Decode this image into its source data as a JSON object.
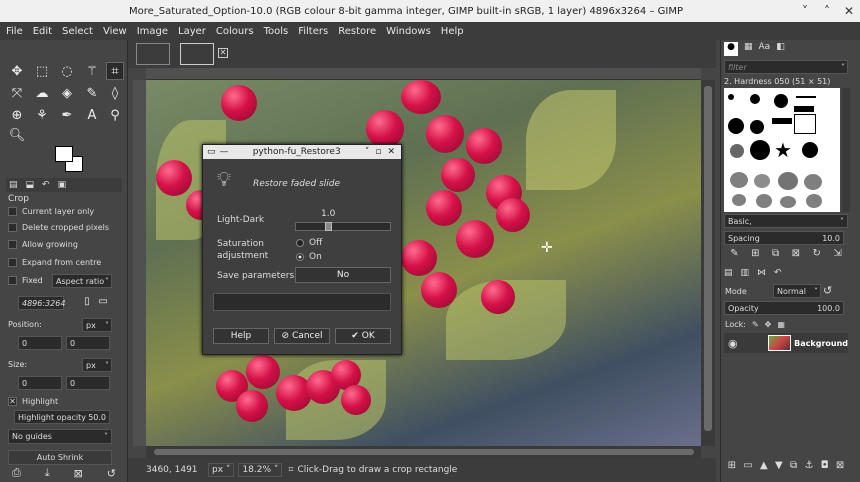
{
  "window": {
    "title": "More_Saturated_Option-10.0 (RGB colour 8-bit gamma integer, GIMP built-in sRGB, 1 layer) 4896x3264 – GIMP"
  },
  "menu": [
    "File",
    "Edit",
    "Select",
    "View",
    "Image",
    "Layer",
    "Colours",
    "Tools",
    "Filters",
    "Restore",
    "Windows",
    "Help"
  ],
  "tool_options": {
    "header": "Crop",
    "current_layer_only": "Current layer only",
    "delete_cropped_pixels": "Delete cropped pixels",
    "allow_growing": "Allow growing",
    "expand_from_centre": "Expand from centre",
    "fixed": "Fixed",
    "aspect_ratio": "Aspect ratio",
    "ratio_value": "4896:3264",
    "position_label": "Position:",
    "position_unit": "px",
    "position_x": "0",
    "position_y": "0",
    "size_label": "Size:",
    "size_unit": "px",
    "size_w": "0",
    "size_h": "0",
    "highlight": "Highlight",
    "highlight_opacity_label": "Highlight opacity",
    "highlight_opacity_value": "50.0",
    "guides": "No guides",
    "auto_shrink": "Auto Shrink"
  },
  "status": {
    "coords": "3460, 1491",
    "unit": "px",
    "zoom": "18.2%",
    "message": "Click-Drag to draw a crop rectangle"
  },
  "brushes": {
    "filter_placeholder": "filter",
    "selected": "2. Hardness 050 (51 × 51)",
    "preset": "Basic,",
    "spacing_label": "Spacing",
    "spacing_value": "10.0"
  },
  "layers": {
    "mode_label": "Mode",
    "mode_value": "Normal",
    "opacity_label": "Opacity",
    "opacity_value": "100.0",
    "lock_label": "Lock:",
    "layer_name": "Background"
  },
  "dialog": {
    "title": "python-fu_Restore3",
    "heading": "Restore faded slide",
    "light_dark_label": "Light-Dark",
    "light_dark_value": "1.0",
    "light_dark_level": 0.33,
    "saturation_label": "Saturation adjustment",
    "sat_off": "Off",
    "sat_on": "On",
    "save_label": "Save parameters",
    "save_value": "No",
    "help": "Help",
    "cancel": "Cancel",
    "ok": "OK"
  },
  "colors": {
    "berry": "#d41148",
    "bg": "#454545",
    "dialog_bg": "#3f3f3f"
  }
}
